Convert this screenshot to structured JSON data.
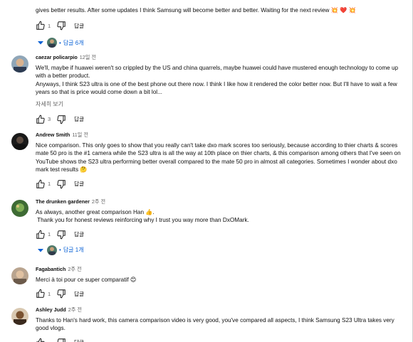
{
  "comments": [
    {
      "text_lines": [
        "gives better results. After some updates I think Samsung will become better and better. Waiting for the next review 💥 ❤️ 💥"
      ],
      "likes": "1",
      "reply_label": "답글",
      "replies_label": "답글 6개"
    },
    {
      "author": "caezar policarpio",
      "time": "12일 전",
      "text_lines": [
        "We'll, maybe if huawei weren't so crippled by the US and china quarrels, maybe huawei could have mustered enough technology to come up with a better product.",
        "Anyways, I think S23 ultra is one of the best phone out there now. I think I like how it rendered the color better now.  But I'll have to wait a few years so that is price would come down a bit lol..."
      ],
      "read_more": "자세히 보기",
      "likes": "3",
      "reply_label": "답글"
    },
    {
      "author": "Andrew Smith",
      "time": "11일 전",
      "text_lines": [
        "Nice comparison. This only goes to show that you really can't take dxo mark scores too seriously, because according to thier charts & scores mate 50 pro is the #1 camera while the S23 ultra is all the way at 10th place on thier charts, & this comparison among others that I've seen on YouTube shows the S23 ultra performing better overall compared to the mate 50 pro in almost all categories. Sometimes I wonder about dxo mark test results 🤔"
      ],
      "likes": "1",
      "reply_label": "답글"
    },
    {
      "author": "The drunken gardener",
      "time": "2주 전",
      "text_lines": [
        "As always, another great comparison Han 👍.",
        " Thank you for honest reviews reinforcing why I trust you way more than DxOMark."
      ],
      "likes": "1",
      "reply_label": "답글",
      "replies_label": "답글 1개"
    },
    {
      "author": "Fagabantich",
      "time": "2주 전",
      "text_lines": [
        "Merci à toi pour ce super comparatif 😊"
      ],
      "likes": "1",
      "reply_label": "답글"
    },
    {
      "author": "Ashley Judd",
      "time": "2주 전",
      "text_lines": [
        "Thanks to Han's hard work, this camera comparison video is very good, you've compared all aspects, I think Samsung S23 Ultra takes very good vlogs."
      ],
      "likes": "",
      "reply_label": "답글"
    }
  ],
  "colors": {
    "link_blue": "#065fd4",
    "text": "#0f0f0f",
    "muted": "#606060"
  },
  "icons": {
    "like": "thumb-up-icon",
    "dislike": "thumb-down-icon",
    "expand": "caret-down-icon"
  }
}
